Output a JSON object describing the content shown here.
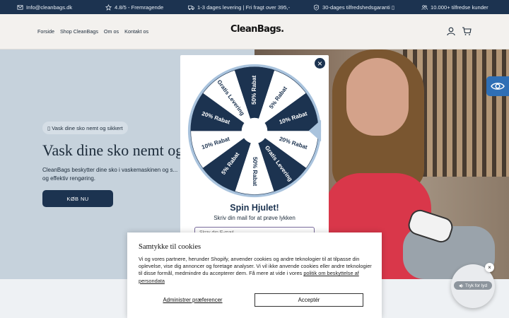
{
  "topbar": {
    "email": "Info@cleanbags.dk",
    "rating": "4.8/5 - Fremragende",
    "shipping": "1-3 dages levering | Fri fragt over 395,-",
    "guarantee": "30-dages tilfredshedsgaranti ▯",
    "customers": "10.000+ tilfredse kunder"
  },
  "header": {
    "nav": [
      "Forside",
      "Shop CleanBags",
      "Om os",
      "Kontakt os"
    ],
    "logo": "CleanBags."
  },
  "hero": {
    "badge": "▯ Vask dine sko nemt og sikkert",
    "title": "Vask dine sko nemt og",
    "text": "CleanBags beskytter dine sko i vaskemaskinen og s... og effektiv rengøring.",
    "cta": "KØB NU"
  },
  "popup": {
    "wheel_segments": [
      {
        "label": "5% Rabat",
        "fill": "#ffffff",
        "text": "#1c3350"
      },
      {
        "label": "10% Rabat",
        "fill": "#1c3350",
        "text": "#ffffff"
      },
      {
        "label": "20% Rabat",
        "fill": "#ffffff",
        "text": "#1c3350"
      },
      {
        "label": "Gratis Levering",
        "fill": "#1c3350",
        "text": "#ffffff"
      },
      {
        "label": "50% Rabat",
        "fill": "#ffffff",
        "text": "#1c3350"
      },
      {
        "label": "5% Rabat",
        "fill": "#1c3350",
        "text": "#ffffff"
      },
      {
        "label": "10% Rabat",
        "fill": "#ffffff",
        "text": "#1c3350"
      },
      {
        "label": "20% Rabat",
        "fill": "#1c3350",
        "text": "#ffffff"
      },
      {
        "label": "Gratis Levering",
        "fill": "#ffffff",
        "text": "#1c3350"
      },
      {
        "label": "50% Rabat",
        "fill": "#1c3350",
        "text": "#ffffff"
      }
    ],
    "title": "Spin Hjulet!",
    "subtitle": "Skriv din mail for at prøve lykken",
    "email_placeholder": "Skriv din E-mail"
  },
  "cookie": {
    "title": "Samtykke til cookies",
    "text": "Vi og vores partnere, herunder Shopify, anvender cookies og andre teknologier til at tilpasse din oplevelse, vise dig annoncer og foretage analyser. Vi vil ikke anvende cookies eller andre teknologier til disse formål, medmindre du accepterer dem. Få mere at vide i vores ",
    "link": "politik om beskyttelse af persondata",
    "manage": "Administrer præferencer",
    "accept": "Acceptér"
  },
  "sound": {
    "label": "Tryk for lyd"
  },
  "colors": {
    "navy": "#1c3350",
    "hero_bg": "#c6d2dc",
    "accent_blue": "#2f6fb5"
  }
}
